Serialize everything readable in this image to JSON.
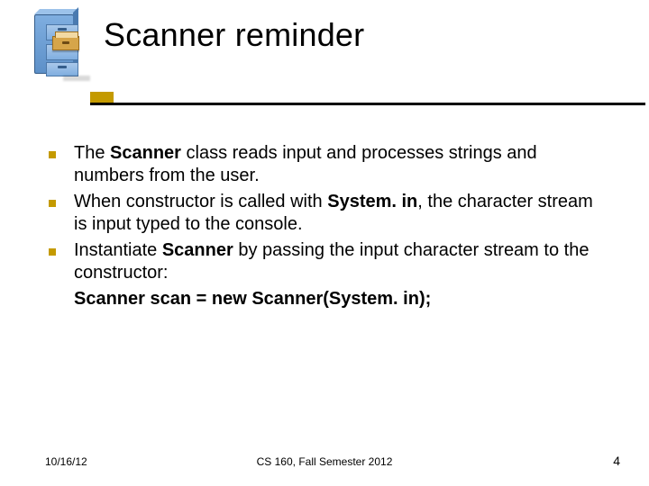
{
  "title": "Scanner reminder",
  "bullets": [
    {
      "pre": "The ",
      "b1": "Scanner",
      "post1": " class reads input and processes strings and numbers from the user."
    },
    {
      "pre": "When constructor is called with ",
      "b1": "System. in",
      "post1": ", the character stream is input typed to the console."
    },
    {
      "pre": "Instantiate ",
      "b1": "Scanner",
      "post1": " by passing the input character stream to the constructor:"
    }
  ],
  "extra_line": "Scanner scan = new Scanner(System. in);",
  "footer": {
    "date": "10/16/12",
    "center": "CS 160, Fall Semester 2012",
    "page": "4"
  },
  "icon": "file-cabinet-icon"
}
